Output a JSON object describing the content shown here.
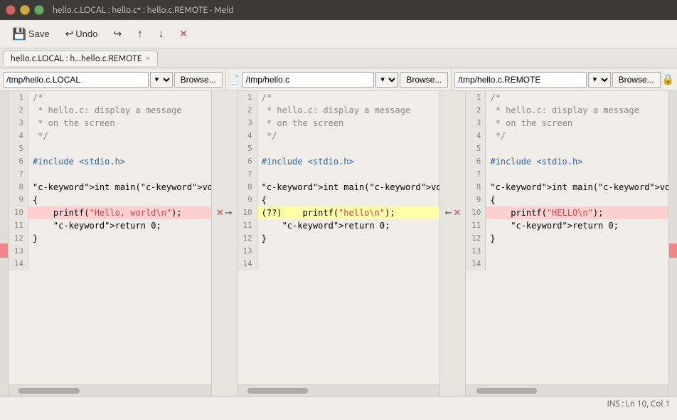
{
  "window": {
    "title": "hello.c.LOCAL : hello.c* : hello.c.REMOTE - Meld",
    "buttons": {
      "close": "×",
      "minimize": "–",
      "maximize": "□"
    }
  },
  "toolbar": {
    "save_label": "Save",
    "undo_label": "Undo"
  },
  "tab": {
    "label": "hello.c.LOCAL : h...hello.c.REMOTE",
    "close": "×"
  },
  "panels": [
    {
      "id": "local",
      "path": "/tmp/hello.c.LOCAL",
      "browse_label": "Browse...",
      "lines": [
        {
          "num": 1,
          "content": "/*",
          "type": "normal"
        },
        {
          "num": 2,
          "content": " * hello.c: display a message",
          "type": "normal"
        },
        {
          "num": 3,
          "content": " * on the screen",
          "type": "normal"
        },
        {
          "num": 4,
          "content": " */",
          "type": "normal"
        },
        {
          "num": 5,
          "content": "",
          "type": "normal"
        },
        {
          "num": 6,
          "content": "#include <stdio.h>",
          "type": "normal"
        },
        {
          "num": 7,
          "content": "",
          "type": "normal"
        },
        {
          "num": 8,
          "content": "int main(void)",
          "type": "normal"
        },
        {
          "num": 9,
          "content": "{",
          "type": "normal"
        },
        {
          "num": 10,
          "content": "    printf(\"Hello, world\\n\");",
          "type": "changed"
        },
        {
          "num": 11,
          "content": "    return 0;",
          "type": "normal"
        },
        {
          "num": 12,
          "content": "}",
          "type": "normal"
        },
        {
          "num": 13,
          "content": "",
          "type": "normal"
        },
        {
          "num": 14,
          "content": "",
          "type": "normal"
        }
      ]
    },
    {
      "id": "center",
      "path": "/tmp/hello.c",
      "browse_label": "Browse...",
      "lines": [
        {
          "num": 1,
          "content": "/*",
          "type": "normal"
        },
        {
          "num": 2,
          "content": " * hello.c: display a message",
          "type": "normal"
        },
        {
          "num": 3,
          "content": " * on the screen",
          "type": "normal"
        },
        {
          "num": 4,
          "content": " */",
          "type": "normal"
        },
        {
          "num": 5,
          "content": "",
          "type": "normal"
        },
        {
          "num": 6,
          "content": "#include <stdio.h>",
          "type": "normal"
        },
        {
          "num": 7,
          "content": "",
          "type": "normal"
        },
        {
          "num": 8,
          "content": "int main(void)",
          "type": "normal"
        },
        {
          "num": 9,
          "content": "{",
          "type": "normal"
        },
        {
          "num": 10,
          "content": "(??)    printf(\"hello\\n\");",
          "type": "changed-center"
        },
        {
          "num": 11,
          "content": "    return 0;",
          "type": "normal"
        },
        {
          "num": 12,
          "content": "}",
          "type": "normal"
        },
        {
          "num": 13,
          "content": "",
          "type": "normal"
        },
        {
          "num": 14,
          "content": "",
          "type": "normal"
        }
      ]
    },
    {
      "id": "remote",
      "path": "/tmp/hello.c.REMOTE",
      "browse_label": "Browse...",
      "lines": [
        {
          "num": 1,
          "content": "/*",
          "type": "normal"
        },
        {
          "num": 2,
          "content": " * hello.c: display a message",
          "type": "normal"
        },
        {
          "num": 3,
          "content": " * on the screen",
          "type": "normal"
        },
        {
          "num": 4,
          "content": " */",
          "type": "normal"
        },
        {
          "num": 5,
          "content": "",
          "type": "normal"
        },
        {
          "num": 6,
          "content": "#include <stdio.h>",
          "type": "normal"
        },
        {
          "num": 7,
          "content": "",
          "type": "normal"
        },
        {
          "num": 8,
          "content": "int main(void)",
          "type": "normal"
        },
        {
          "num": 9,
          "content": "{",
          "type": "normal"
        },
        {
          "num": 10,
          "content": "    printf(\"HELLO\\n\");",
          "type": "changed"
        },
        {
          "num": 11,
          "content": "    return 0;",
          "type": "normal"
        },
        {
          "num": 12,
          "content": "}",
          "type": "normal"
        },
        {
          "num": 13,
          "content": "",
          "type": "normal"
        },
        {
          "num": 14,
          "content": "",
          "type": "normal"
        }
      ]
    }
  ],
  "statusbar": {
    "text": "INS : Ln 10, Col 1"
  },
  "icons": {
    "save": "💾",
    "undo": "↩",
    "redo": "↪",
    "up": "↑",
    "down": "↓",
    "stop": "✕",
    "arrow_right": "→",
    "arrow_left": "←",
    "x_mark": "✕",
    "lock": "🔒"
  }
}
